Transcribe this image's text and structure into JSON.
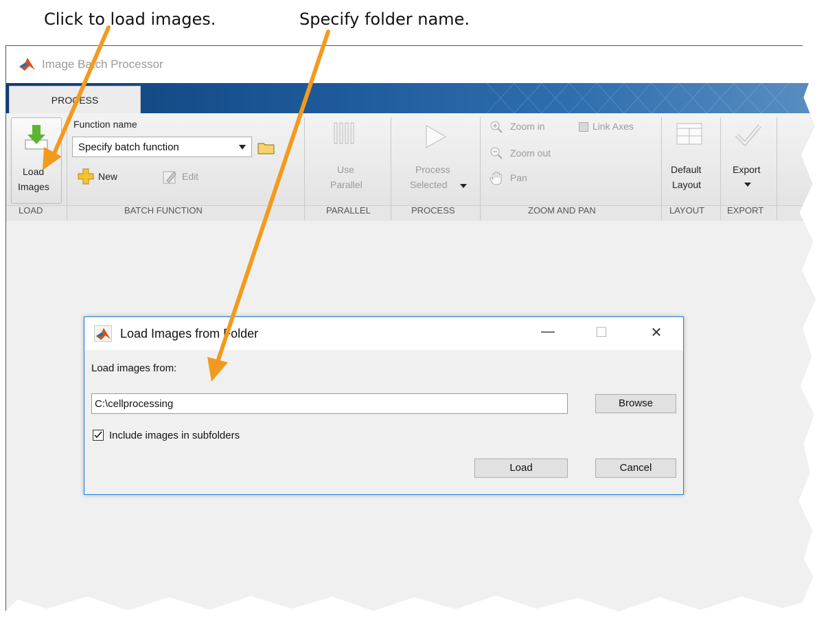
{
  "annotations": {
    "load_hint": "Click to load images.",
    "folder_hint": "Specify folder name."
  },
  "window": {
    "title": "Image Batch Processor"
  },
  "tabs": [
    {
      "label": "PROCESS"
    }
  ],
  "toolstrip": {
    "load": {
      "line1": "Load",
      "line2": "Images",
      "section": "LOAD"
    },
    "batch_function": {
      "label": "Function name",
      "value": "Specify batch function",
      "new": "New",
      "edit": "Edit",
      "section": "BATCH FUNCTION"
    },
    "parallel": {
      "line1": "Use",
      "line2": "Parallel",
      "section": "PARALLEL"
    },
    "process": {
      "line1": "Process",
      "line2": "Selected",
      "section": "PROCESS"
    },
    "zoom": {
      "zoom_in": "Zoom in",
      "zoom_out": "Zoom out",
      "pan": "Pan",
      "link_axes": "Link Axes",
      "section": "ZOOM AND PAN"
    },
    "layout": {
      "line1": "Default",
      "line2": "Layout",
      "section": "LAYOUT"
    },
    "export": {
      "line1": "Export",
      "section": "EXPORT"
    }
  },
  "dialog": {
    "title": "Load Images from Folder",
    "load_from_label": "Load images from:",
    "path_value": "C:\\cellprocessing",
    "browse": "Browse",
    "include_subfolders": "Include images in subfolders",
    "include_subfolders_checked": true,
    "load": "Load",
    "cancel": "Cancel"
  },
  "colors": {
    "annotation_arrow": "#f39a1e",
    "tab_gradient_start": "#0c3f78",
    "dialog_border": "#1a7fd6"
  },
  "icons": [
    "matlab-logo-icon",
    "load-images-icon",
    "folder-icon",
    "plus-icon",
    "edit-icon",
    "parallel-icon",
    "play-icon",
    "zoom-in-icon",
    "zoom-out-icon",
    "pan-hand-icon",
    "layout-icon",
    "checkmark-icon"
  ]
}
